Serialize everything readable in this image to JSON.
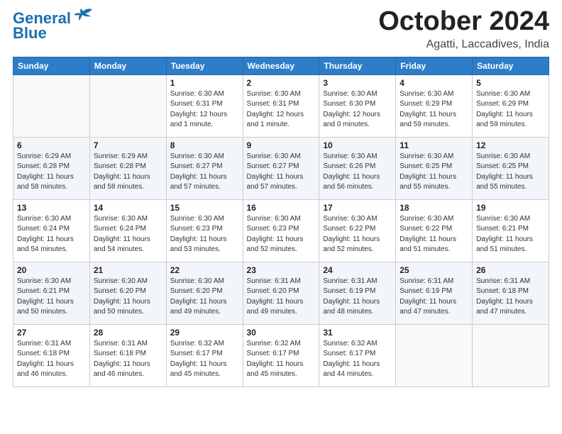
{
  "header": {
    "logo_line1": "General",
    "logo_line2": "Blue",
    "month": "October 2024",
    "location": "Agatti, Laccadives, India"
  },
  "weekdays": [
    "Sunday",
    "Monday",
    "Tuesday",
    "Wednesday",
    "Thursday",
    "Friday",
    "Saturday"
  ],
  "weeks": [
    [
      {
        "day": "",
        "info": ""
      },
      {
        "day": "",
        "info": ""
      },
      {
        "day": "1",
        "info": "Sunrise: 6:30 AM\nSunset: 6:31 PM\nDaylight: 12 hours\nand 1 minute."
      },
      {
        "day": "2",
        "info": "Sunrise: 6:30 AM\nSunset: 6:31 PM\nDaylight: 12 hours\nand 1 minute."
      },
      {
        "day": "3",
        "info": "Sunrise: 6:30 AM\nSunset: 6:30 PM\nDaylight: 12 hours\nand 0 minutes."
      },
      {
        "day": "4",
        "info": "Sunrise: 6:30 AM\nSunset: 6:29 PM\nDaylight: 11 hours\nand 59 minutes."
      },
      {
        "day": "5",
        "info": "Sunrise: 6:30 AM\nSunset: 6:29 PM\nDaylight: 11 hours\nand 59 minutes."
      }
    ],
    [
      {
        "day": "6",
        "info": "Sunrise: 6:29 AM\nSunset: 6:28 PM\nDaylight: 11 hours\nand 58 minutes."
      },
      {
        "day": "7",
        "info": "Sunrise: 6:29 AM\nSunset: 6:28 PM\nDaylight: 11 hours\nand 58 minutes."
      },
      {
        "day": "8",
        "info": "Sunrise: 6:30 AM\nSunset: 6:27 PM\nDaylight: 11 hours\nand 57 minutes."
      },
      {
        "day": "9",
        "info": "Sunrise: 6:30 AM\nSunset: 6:27 PM\nDaylight: 11 hours\nand 57 minutes."
      },
      {
        "day": "10",
        "info": "Sunrise: 6:30 AM\nSunset: 6:26 PM\nDaylight: 11 hours\nand 56 minutes."
      },
      {
        "day": "11",
        "info": "Sunrise: 6:30 AM\nSunset: 6:25 PM\nDaylight: 11 hours\nand 55 minutes."
      },
      {
        "day": "12",
        "info": "Sunrise: 6:30 AM\nSunset: 6:25 PM\nDaylight: 11 hours\nand 55 minutes."
      }
    ],
    [
      {
        "day": "13",
        "info": "Sunrise: 6:30 AM\nSunset: 6:24 PM\nDaylight: 11 hours\nand 54 minutes."
      },
      {
        "day": "14",
        "info": "Sunrise: 6:30 AM\nSunset: 6:24 PM\nDaylight: 11 hours\nand 54 minutes."
      },
      {
        "day": "15",
        "info": "Sunrise: 6:30 AM\nSunset: 6:23 PM\nDaylight: 11 hours\nand 53 minutes."
      },
      {
        "day": "16",
        "info": "Sunrise: 6:30 AM\nSunset: 6:23 PM\nDaylight: 11 hours\nand 52 minutes."
      },
      {
        "day": "17",
        "info": "Sunrise: 6:30 AM\nSunset: 6:22 PM\nDaylight: 11 hours\nand 52 minutes."
      },
      {
        "day": "18",
        "info": "Sunrise: 6:30 AM\nSunset: 6:22 PM\nDaylight: 11 hours\nand 51 minutes."
      },
      {
        "day": "19",
        "info": "Sunrise: 6:30 AM\nSunset: 6:21 PM\nDaylight: 11 hours\nand 51 minutes."
      }
    ],
    [
      {
        "day": "20",
        "info": "Sunrise: 6:30 AM\nSunset: 6:21 PM\nDaylight: 11 hours\nand 50 minutes."
      },
      {
        "day": "21",
        "info": "Sunrise: 6:30 AM\nSunset: 6:20 PM\nDaylight: 11 hours\nand 50 minutes."
      },
      {
        "day": "22",
        "info": "Sunrise: 6:30 AM\nSunset: 6:20 PM\nDaylight: 11 hours\nand 49 minutes."
      },
      {
        "day": "23",
        "info": "Sunrise: 6:31 AM\nSunset: 6:20 PM\nDaylight: 11 hours\nand 49 minutes."
      },
      {
        "day": "24",
        "info": "Sunrise: 6:31 AM\nSunset: 6:19 PM\nDaylight: 11 hours\nand 48 minutes."
      },
      {
        "day": "25",
        "info": "Sunrise: 6:31 AM\nSunset: 6:19 PM\nDaylight: 11 hours\nand 47 minutes."
      },
      {
        "day": "26",
        "info": "Sunrise: 6:31 AM\nSunset: 6:18 PM\nDaylight: 11 hours\nand 47 minutes."
      }
    ],
    [
      {
        "day": "27",
        "info": "Sunrise: 6:31 AM\nSunset: 6:18 PM\nDaylight: 11 hours\nand 46 minutes."
      },
      {
        "day": "28",
        "info": "Sunrise: 6:31 AM\nSunset: 6:18 PM\nDaylight: 11 hours\nand 46 minutes."
      },
      {
        "day": "29",
        "info": "Sunrise: 6:32 AM\nSunset: 6:17 PM\nDaylight: 11 hours\nand 45 minutes."
      },
      {
        "day": "30",
        "info": "Sunrise: 6:32 AM\nSunset: 6:17 PM\nDaylight: 11 hours\nand 45 minutes."
      },
      {
        "day": "31",
        "info": "Sunrise: 6:32 AM\nSunset: 6:17 PM\nDaylight: 11 hours\nand 44 minutes."
      },
      {
        "day": "",
        "info": ""
      },
      {
        "day": "",
        "info": ""
      }
    ]
  ]
}
